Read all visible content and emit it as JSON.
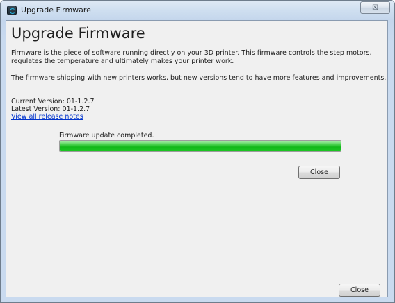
{
  "window": {
    "title": "Upgrade Firmware",
    "close_glyph": "☒"
  },
  "content": {
    "heading": "Upgrade Firmware",
    "paragraph1": "Firmware is the piece of software running directly on your 3D printer. This firmware controls the step motors, regulates the temperature and ultimately makes your printer work.",
    "paragraph2": "The firmware shipping with new printers works, but new versions tend to have more features and improvements.",
    "current_version": "Current Version: 01-1.2.7",
    "latest_version": "Latest Version: 01-1.2.7",
    "release_notes_link": "View all release notes"
  },
  "progress": {
    "status_text": "Firmware update completed.",
    "value": 1.0,
    "color": "#1cc623"
  },
  "buttons": {
    "inner_close_label": "Close",
    "bottom_close_label": "Close"
  },
  "icons": {
    "app_icon": "app-logo-icon",
    "window_close": "close-icon"
  }
}
